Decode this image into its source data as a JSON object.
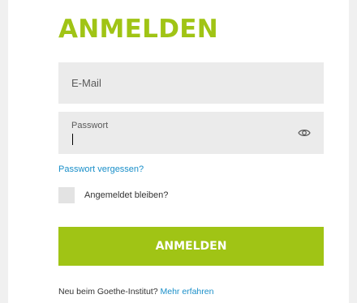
{
  "login": {
    "title": "ANMELDEN",
    "email": {
      "placeholder": "E-Mail",
      "value": ""
    },
    "password": {
      "label": "Passwort",
      "value": "",
      "toggle_icon": "eye-icon"
    },
    "forgot_link": "Passwort vergessen?",
    "remember": {
      "label": "Angemeldet bleiben?",
      "checked": false
    },
    "submit_label": "ANMELDEN",
    "footer": {
      "text": "Neu beim Goethe-Institut? ",
      "link": "Mehr erfahren"
    }
  },
  "colors": {
    "accent": "#a0c415",
    "link": "#1a8fc9",
    "field_bg": "#ebebeb"
  }
}
